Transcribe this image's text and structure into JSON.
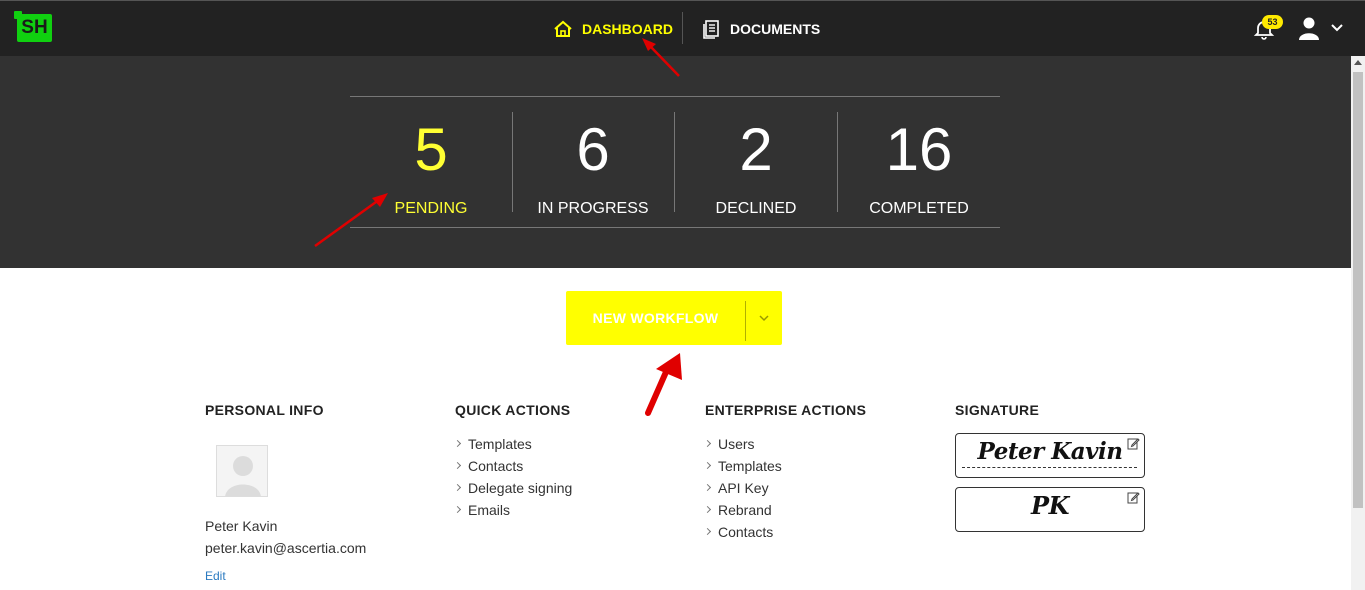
{
  "app": {
    "logo_text": "SH",
    "brand_color": "#10d010",
    "accent_color": "#ffff00"
  },
  "nav": {
    "dashboard": {
      "label": "DASHBOARD",
      "icon": "home-icon"
    },
    "documents": {
      "label": "DOCUMENTS",
      "icon": "document-icon"
    },
    "notifications_count": "53",
    "user_icon": "user-icon"
  },
  "stats": [
    {
      "value": "5",
      "label": "PENDING"
    },
    {
      "value": "6",
      "label": "IN PROGRESS"
    },
    {
      "value": "2",
      "label": "DECLINED"
    },
    {
      "value": "16",
      "label": "COMPLETED"
    }
  ],
  "new_workflow": {
    "label": "NEW WORKFLOW"
  },
  "personal_info": {
    "title": "PERSONAL INFO",
    "name": "Peter Kavin",
    "email": "peter.kavin@ascertia.com",
    "edit_label": "Edit"
  },
  "quick_actions": {
    "title": "QUICK ACTIONS",
    "items": [
      "Templates",
      "Contacts",
      "Delegate signing",
      "Emails"
    ]
  },
  "enterprise_actions": {
    "title": "ENTERPRISE ACTIONS",
    "items": [
      "Users",
      "Templates",
      "API Key",
      "Rebrand",
      "Contacts"
    ]
  },
  "signature": {
    "title": "SIGNATURE",
    "signature_text": "Peter Kavin",
    "initials_text": "PK"
  }
}
